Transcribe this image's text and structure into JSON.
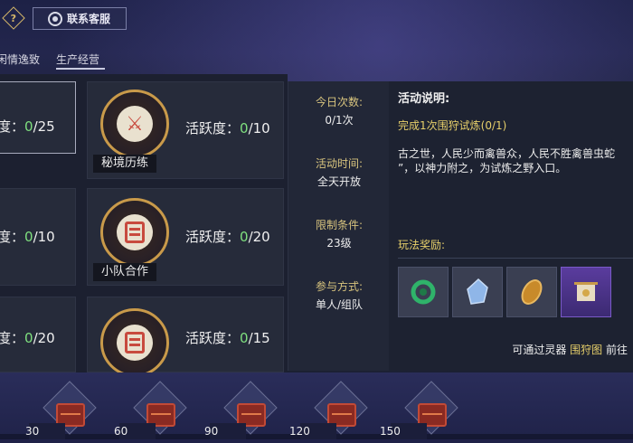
{
  "header": {
    "help_glyph": "?",
    "service_label": "联系客服"
  },
  "tabs": [
    {
      "label": "闲情逸致"
    },
    {
      "label": "生产经营"
    }
  ],
  "cards": [
    {
      "activity_label": "度：",
      "current": "0",
      "max": "/25"
    },
    {
      "name": "秘境历练",
      "activity_label": "活跃度：",
      "current": "0",
      "max": "/10"
    },
    {
      "activity_label": "度：",
      "current": "0",
      "max": "/10"
    },
    {
      "name": "小队合作",
      "activity_label": "活跃度：",
      "current": "0",
      "max": "/20"
    },
    {
      "activity_label": "度：",
      "current": "0",
      "max": "/20"
    },
    {
      "activity_label": "活跃度：",
      "current": "0",
      "max": "/15"
    }
  ],
  "info": {
    "daily_label": "今日次数:",
    "daily_value": "0/1次",
    "time_label": "活动时间:",
    "time_value": "全天开放",
    "limit_label": "限制条件:",
    "limit_value": "23级",
    "mode_label": "参与方式:",
    "mode_value": "单人/组队"
  },
  "description": {
    "title": "活动说明:",
    "task": "完成1次围狩试炼(0/1)",
    "body_line1": "古之世，人民少而禽兽众，人民不胜禽兽虫蛇",
    "body_line2": "”，以神力附之，为试炼之野入口。",
    "reward_title": "玩法奖励:",
    "reward_note_prefix": "可通过灵器 ",
    "reward_note_link": "围狩图",
    "reward_note_suffix": " 前往"
  },
  "rewards": [
    {
      "icon": "jade-ring-icon"
    },
    {
      "icon": "crystal-icon"
    },
    {
      "icon": "bronze-relic-icon"
    },
    {
      "icon": "scroll-painting-icon"
    }
  ],
  "milestones": [
    "30",
    "60",
    "90",
    "120",
    "150"
  ]
}
